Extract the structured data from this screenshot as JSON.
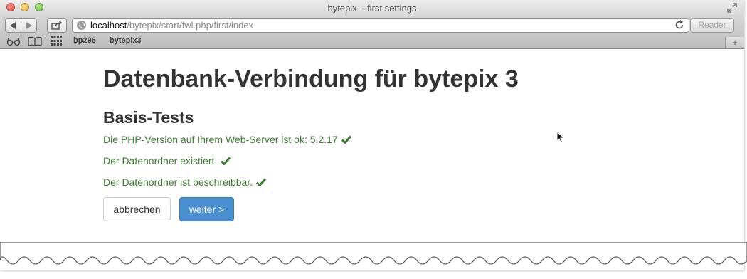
{
  "window": {
    "title": "bytepix – first settings"
  },
  "toolbar": {
    "url_host": "localhost",
    "url_path": "/bytepix/start/fwl.php/first/index",
    "reader_label": "Reader"
  },
  "bookmarks": [
    "bp296",
    "bytepix3"
  ],
  "icons": {
    "back": "back-arrow-icon",
    "forward": "forward-arrow-icon",
    "share": "share-icon",
    "globe": "globe-icon",
    "reload": "reload-icon",
    "reading_list": "glasses-icon",
    "bookmarks": "book-icon",
    "top_sites": "grid-icon",
    "check": "checkmark-icon",
    "cursor": "mouse-cursor-icon",
    "fullscreen": "fullscreen-icon",
    "new_tab": "plus-icon"
  },
  "page": {
    "title": "Datenbank-Verbindung für bytepix 3",
    "section_title": "Basis-Tests",
    "checks": [
      "Die PHP-Version auf Ihrem Web-Server ist ok: 5.2.17",
      "Der Datenordner existiert.",
      "Der Datenordner ist beschreibbar."
    ],
    "cancel_label": "abbrechen",
    "next_label": "weiter >"
  },
  "colors": {
    "success_text": "#3d7a33",
    "primary_button": "#4a8fd0",
    "heading": "#333333"
  }
}
